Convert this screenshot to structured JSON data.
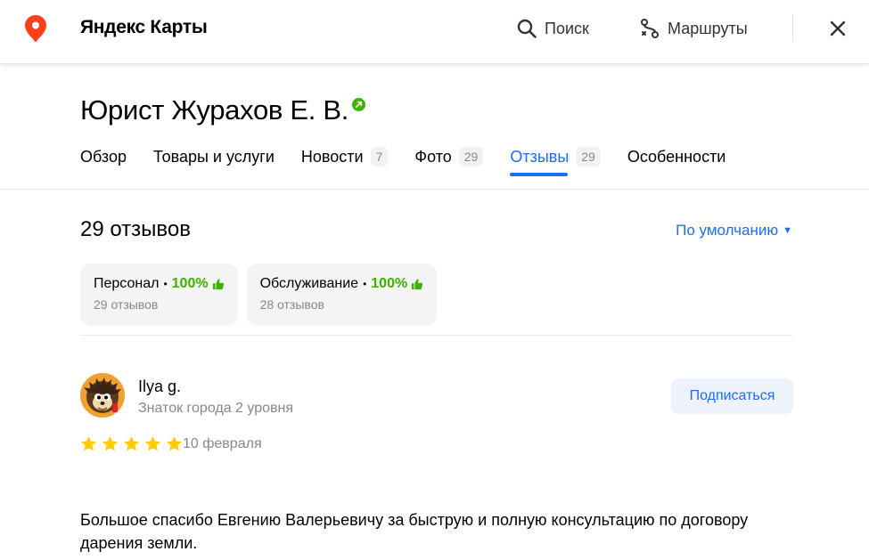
{
  "header": {
    "logo_text": "Яндекс Карты",
    "search_label": "Поиск",
    "routes_label": "Маршруты",
    "brand_color": "#fc3f1d"
  },
  "org": {
    "title": "Юрист Журахов Е. В."
  },
  "tabs": [
    {
      "label": "Обзор",
      "count": ""
    },
    {
      "label": "Товары и услуги",
      "count": ""
    },
    {
      "label": "Новости",
      "count": "7"
    },
    {
      "label": "Фото",
      "count": "29"
    },
    {
      "label": "Отзывы",
      "count": "29",
      "active": true
    },
    {
      "label": "Особенности",
      "count": ""
    }
  ],
  "reviews": {
    "count_label": "29 отзывов",
    "sort_label": "По умолчанию",
    "aspects": [
      {
        "name": "Персонал",
        "percent": "100%",
        "sub": "29 отзывов"
      },
      {
        "name": "Обслуживание",
        "percent": "100%",
        "sub": "28 отзывов"
      }
    ],
    "items": [
      {
        "author": "Ilya g.",
        "level": "Знаток города 2 уровня",
        "subscribe_label": "Подписаться",
        "rating": 5,
        "date": "10 февраля",
        "text": "Большое спасибо Евгению Валерьевичу за быструю и полную консультацию по договору дарения земли."
      }
    ]
  },
  "colors": {
    "accent": "#196dff",
    "positive": "#3bb300",
    "star": "#fc0"
  }
}
